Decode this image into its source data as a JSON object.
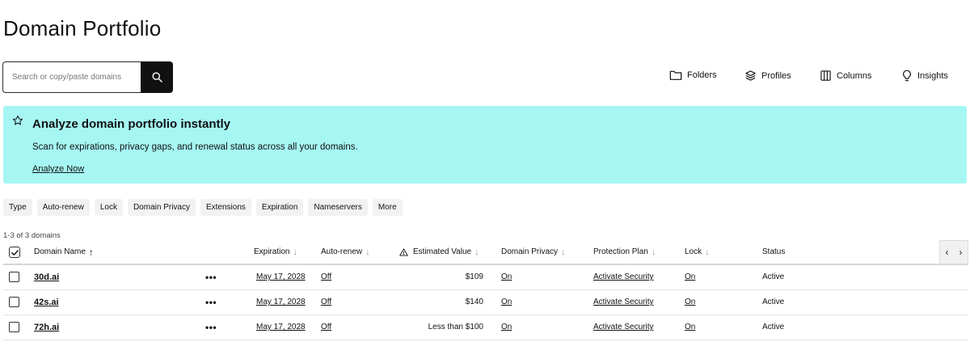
{
  "page": {
    "title": "Domain Portfolio"
  },
  "search": {
    "placeholder": "Search or copy/paste domains"
  },
  "toolbar": {
    "folders": "Folders",
    "profiles": "Profiles",
    "columns": "Columns",
    "insights": "Insights"
  },
  "banner": {
    "title": "Analyze domain portfolio instantly",
    "description": "Scan for expirations, privacy gaps, and renewal status across all your domains.",
    "link": "Analyze Now",
    "background": "#a6f7f4"
  },
  "filters": [
    "Type",
    "Auto-renew",
    "Lock",
    "Domain Privacy",
    "Extensions",
    "Expiration",
    "Nameservers",
    "More"
  ],
  "table": {
    "count": "1-3 of 3 domains",
    "headers": {
      "domain_name": "Domain Name",
      "expiration": "Expiration",
      "auto_renew": "Auto-renew",
      "estimated_value": "Estimated Value",
      "domain_privacy": "Domain Privacy",
      "protection_plan": "Protection Plan",
      "lock": "Lock",
      "status": "Status"
    },
    "rows": [
      {
        "domain": "30d.ai",
        "actions": "•••",
        "expiration": "May 17, 2028",
        "auto_renew": "Off",
        "value": "$109",
        "privacy": "On",
        "protection": "Activate Security",
        "lock": "On",
        "status": "Active"
      },
      {
        "domain": "42s.ai",
        "actions": "•••",
        "expiration": "May 17, 2028",
        "auto_renew": "Off",
        "value": "$140",
        "privacy": "On",
        "protection": "Activate Security",
        "lock": "On",
        "status": "Active"
      },
      {
        "domain": "72h.ai",
        "actions": "•••",
        "expiration": "May 17, 2028",
        "auto_renew": "Off",
        "value": "Less than $100",
        "privacy": "On",
        "protection": "Activate Security",
        "lock": "On",
        "status": "Active"
      }
    ]
  },
  "icons": {
    "search": "search-icon",
    "folders": "folder-icon",
    "profiles": "layers-icon",
    "columns": "columns-icon",
    "insights": "lightbulb-icon",
    "banner": "star-icon"
  }
}
